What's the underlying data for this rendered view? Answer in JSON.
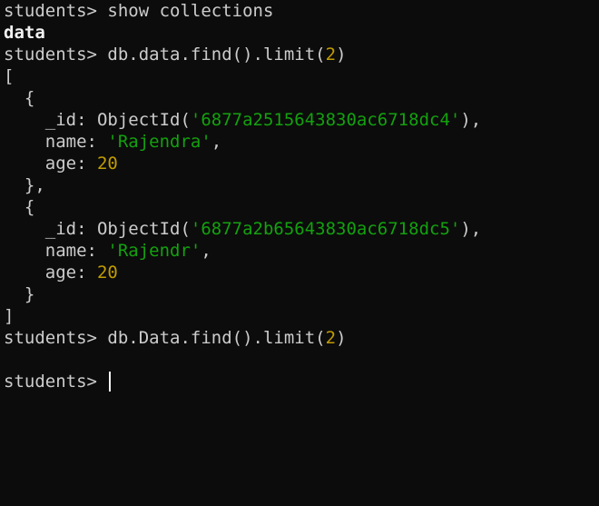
{
  "terminal": {
    "prompt": "students> ",
    "cmd1": "show collections",
    "out1": "data",
    "cmd2": "db.data.find().limit(",
    "cmd2_num": "2",
    "cmd2_end": ")",
    "open_bracket": "[",
    "open_brace": "  {",
    "doc1": {
      "id_key": "    _id: ObjectId(",
      "id_val": "'6877a2515643830ac6718dc4'",
      "id_end": "),",
      "name_key": "    name: ",
      "name_val": "'Rajendra'",
      "name_end": ",",
      "age_key": "    age: ",
      "age_val": "20"
    },
    "close_brace_comma": "  },",
    "doc2": {
      "id_key": "    _id: ObjectId(",
      "id_val": "'6877a2b65643830ac6718dc5'",
      "id_end": "),",
      "name_key": "    name: ",
      "name_val": "'Rajendr'",
      "name_end": ",",
      "age_key": "    age: ",
      "age_val": "20"
    },
    "close_brace": "  }",
    "close_bracket": "]",
    "cmd3": "db.Data.find().limit(",
    "cmd3_num": "2",
    "cmd3_end": ")"
  }
}
